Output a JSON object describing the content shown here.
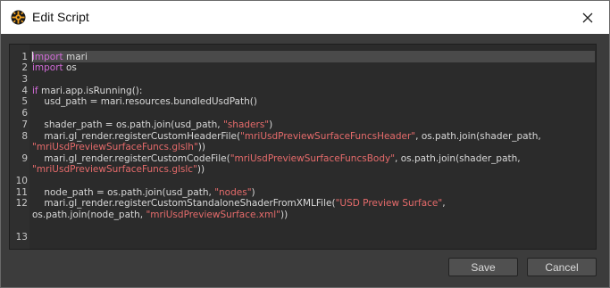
{
  "window": {
    "title": "Edit Script"
  },
  "editor": {
    "lines": [
      {
        "num": "1",
        "segments": [
          {
            "t": "import",
            "c": "kw"
          },
          {
            "t": " mari",
            "c": ""
          }
        ]
      },
      {
        "num": "2",
        "segments": [
          {
            "t": "import",
            "c": "kw"
          },
          {
            "t": " os",
            "c": ""
          }
        ]
      },
      {
        "num": "3",
        "segments": []
      },
      {
        "num": "4",
        "segments": [
          {
            "t": "if",
            "c": "kw"
          },
          {
            "t": " mari.app.isRunning():",
            "c": ""
          }
        ]
      },
      {
        "num": "5",
        "segments": [
          {
            "t": "    usd_path = mari.resources.bundledUsdPath()",
            "c": ""
          }
        ]
      },
      {
        "num": "6",
        "segments": []
      },
      {
        "num": "7",
        "segments": [
          {
            "t": "    shader_path = os.path.join(usd_path, ",
            "c": ""
          },
          {
            "t": "\"shaders\"",
            "c": "str"
          },
          {
            "t": ")",
            "c": ""
          }
        ]
      },
      {
        "num": "8",
        "segments": [
          {
            "t": "    mari.gl_render.registerCustomHeaderFile(",
            "c": ""
          },
          {
            "t": "\"mriUsdPreviewSurfaceFuncsHeader\"",
            "c": "str"
          },
          {
            "t": ", os.path.join(shader_path,",
            "c": ""
          }
        ]
      },
      {
        "num": "",
        "segments": [
          {
            "t": "\"mriUsdPreviewSurfaceFuncs.glslh\"",
            "c": "str"
          },
          {
            "t": "))",
            "c": ""
          }
        ]
      },
      {
        "num": "9",
        "segments": [
          {
            "t": "    mari.gl_render.registerCustomCodeFile(",
            "c": ""
          },
          {
            "t": "\"mriUsdPreviewSurfaceFuncsBody\"",
            "c": "str"
          },
          {
            "t": ", os.path.join(shader_path,",
            "c": ""
          }
        ]
      },
      {
        "num": "",
        "segments": [
          {
            "t": "\"mriUsdPreviewSurfaceFuncs.glslc\"",
            "c": "str"
          },
          {
            "t": "))",
            "c": ""
          }
        ]
      },
      {
        "num": "10",
        "segments": []
      },
      {
        "num": "11",
        "segments": [
          {
            "t": "    node_path = os.path.join(usd_path, ",
            "c": ""
          },
          {
            "t": "\"nodes\"",
            "c": "str"
          },
          {
            "t": ")",
            "c": ""
          }
        ]
      },
      {
        "num": "12",
        "segments": [
          {
            "t": "    mari.gl_render.registerCustomStandaloneShaderFromXMLFile(",
            "c": ""
          },
          {
            "t": "\"USD Preview Surface\"",
            "c": "str"
          },
          {
            "t": ",",
            "c": ""
          }
        ]
      },
      {
        "num": "",
        "segments": [
          {
            "t": "os.path.join(node_path, ",
            "c": ""
          },
          {
            "t": "\"mriUsdPreviewSurface.xml\"",
            "c": "str"
          },
          {
            "t": "))",
            "c": ""
          }
        ]
      },
      {
        "num": "",
        "segments": []
      },
      {
        "num": "13",
        "segments": []
      }
    ]
  },
  "buttons": {
    "save": "Save",
    "cancel": "Cancel"
  },
  "colors": {
    "keyword": "#d06bd6",
    "string": "#e66b6b",
    "text": "#d8d8d8"
  }
}
